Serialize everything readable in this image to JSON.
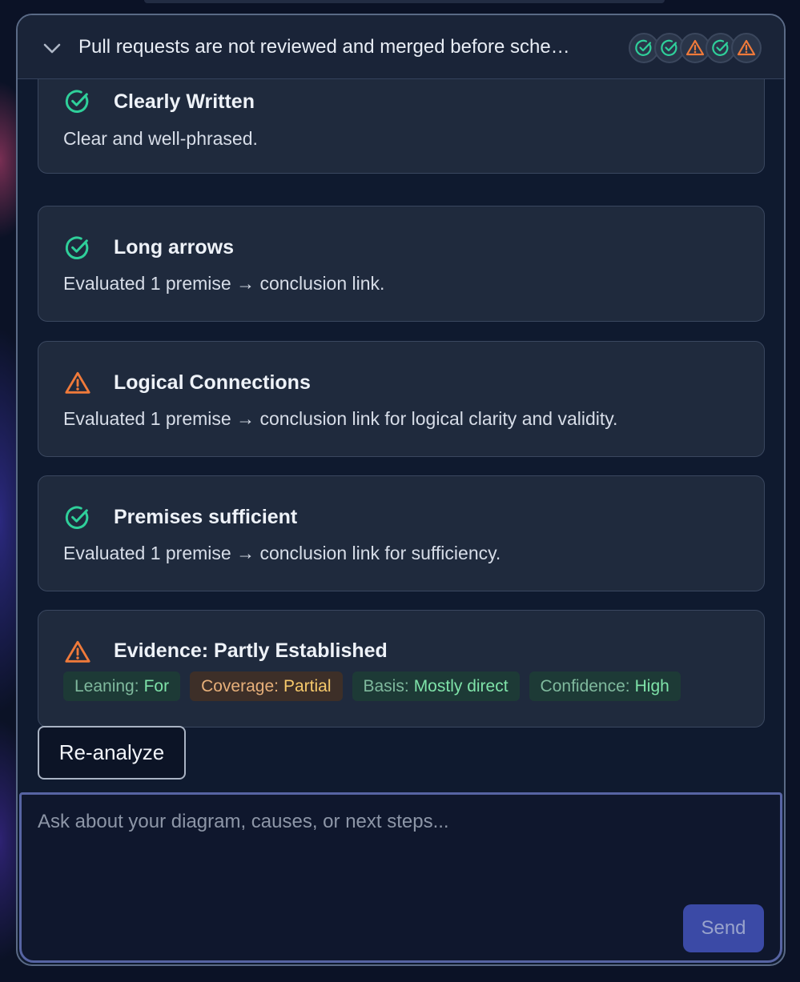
{
  "header": {
    "title": "Pull requests are not reviewed and merged before sche…",
    "status_icons": [
      "check-icon",
      "check-icon",
      "warning-icon",
      "check-icon",
      "warning-icon"
    ]
  },
  "colors": {
    "pass": "#2fcf9a",
    "warn": "#f07a3a"
  },
  "checks": [
    {
      "status": "pass",
      "icon": "check-circle-icon",
      "title": "Clearly Written",
      "description": "Clear and well-phrased."
    },
    {
      "status": "pass",
      "icon": "check-circle-icon",
      "title": "Long arrows",
      "description": "Evaluated 1 premise → conclusion link."
    },
    {
      "status": "warn",
      "icon": "warning-icon",
      "title": "Logical Connections",
      "description": "Evaluated 1 premise → conclusion link for logical clarity and validity."
    },
    {
      "status": "pass",
      "icon": "check-circle-icon",
      "title": "Premises sufficient",
      "description": "Evaluated 1 premise → conclusion link for sufficiency."
    },
    {
      "status": "warn",
      "icon": "warning-icon",
      "title": "Evidence: Partly Established",
      "tags": [
        {
          "key": "Leaning:",
          "value": "For",
          "tone": "green"
        },
        {
          "key": "Coverage:",
          "value": "Partial",
          "tone": "orange"
        },
        {
          "key": "Basis:",
          "value": "Mostly direct",
          "tone": "green"
        },
        {
          "key": "Confidence:",
          "value": "High",
          "tone": "green"
        }
      ]
    }
  ],
  "reanalyze_label": "Re-analyze",
  "composer": {
    "placeholder": "Ask about your diagram, causes, or next steps...",
    "value": "",
    "send_label": "Send"
  }
}
